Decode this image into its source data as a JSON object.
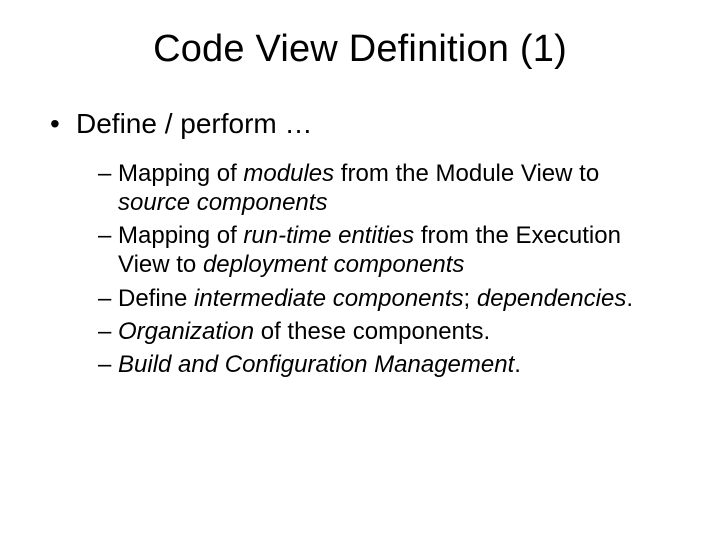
{
  "title": "Code View Definition (1)",
  "bullet_glyph": "•",
  "dash_glyph": "–",
  "top_item": "Define / perform …",
  "sub": {
    "a": {
      "p1": "Mapping of ",
      "i1": "modules",
      "p2": " from the Module View to ",
      "i2": "source components"
    },
    "b": {
      "p1": "Mapping of ",
      "i1": "run-time entities",
      "p2": " from the Execution View to ",
      "i2": "deployment components"
    },
    "c": {
      "p1": "Define ",
      "i1": "intermediate components",
      "p2": "; ",
      "i2": "dependencies",
      "p3": "."
    },
    "d": {
      "i1": "Organization",
      "p1": " of these components."
    },
    "e": {
      "i1": "Build and Configuration Management",
      "p1": "."
    }
  }
}
